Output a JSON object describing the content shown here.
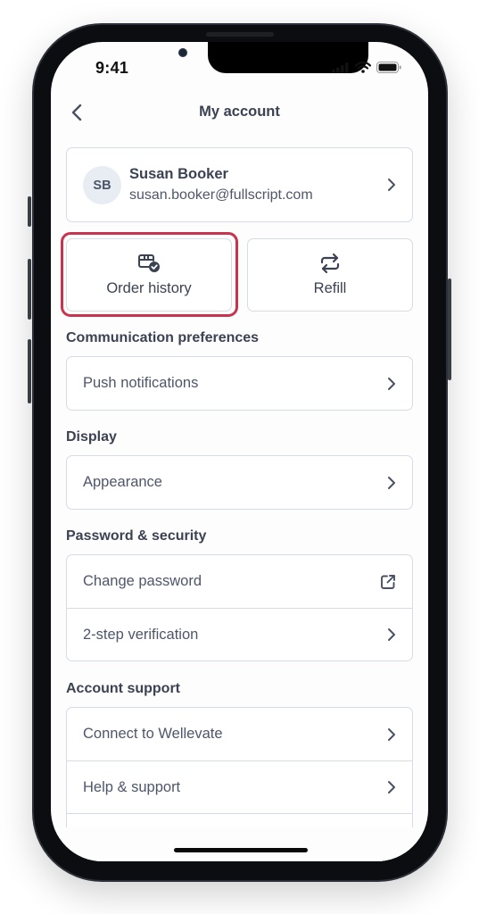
{
  "status_bar": {
    "time": "9:41"
  },
  "nav": {
    "title": "My account",
    "back_icon": "chevron-left-icon"
  },
  "profile": {
    "initials": "SB",
    "name": "Susan Booker",
    "email": "susan.booker@fullscript.com"
  },
  "quick_actions": [
    {
      "label": "Order history",
      "icon": "package-check-icon",
      "highlighted": true
    },
    {
      "label": "Refill",
      "icon": "repeat-arrows-icon",
      "highlighted": false
    }
  ],
  "colors": {
    "highlight": "#c8334e",
    "text_primary": "#3b4252",
    "text_secondary": "#4e566a",
    "border": "#d6dbe4",
    "avatar_bg": "#e8edf4"
  },
  "sections": [
    {
      "title": "Communication preferences",
      "items": [
        {
          "label": "Push notifications",
          "icon": "chevron-right-icon"
        }
      ]
    },
    {
      "title": "Display",
      "items": [
        {
          "label": "Appearance",
          "icon": "chevron-right-icon"
        }
      ]
    },
    {
      "title": "Password & security",
      "items": [
        {
          "label": "Change password",
          "icon": "external-link-icon"
        },
        {
          "label": "2-step verification",
          "icon": "chevron-right-icon"
        }
      ]
    },
    {
      "title": "Account support",
      "items": [
        {
          "label": "Connect to Wellevate",
          "icon": "chevron-right-icon"
        },
        {
          "label": "Help & support",
          "icon": "chevron-right-icon"
        },
        {
          "label": "",
          "icon": ""
        }
      ]
    }
  ]
}
